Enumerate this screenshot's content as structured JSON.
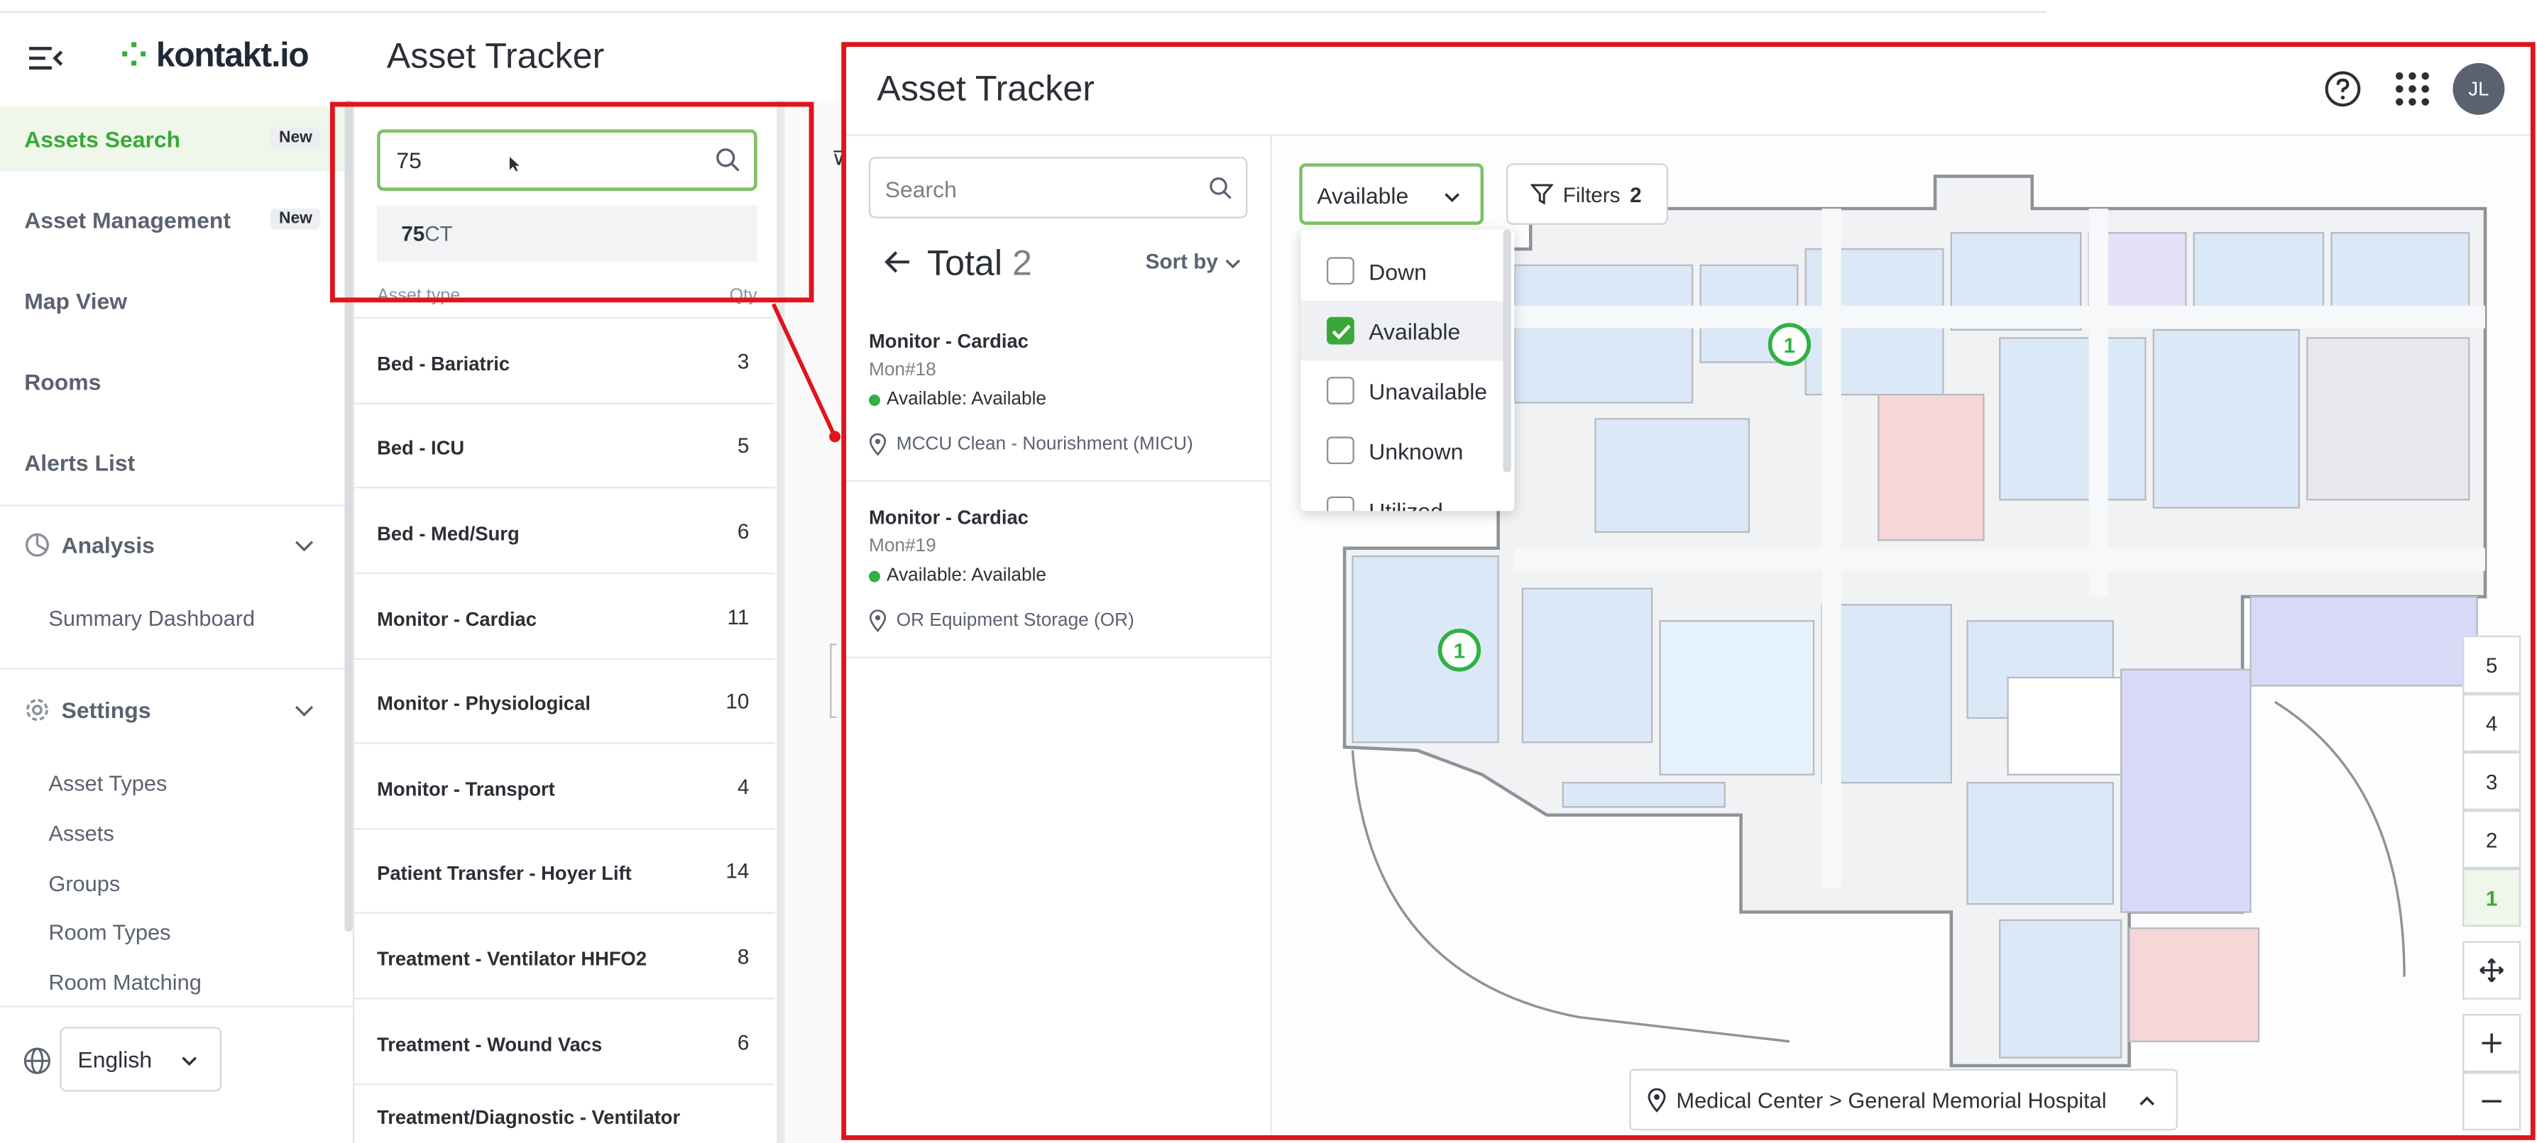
{
  "app": {
    "brand": "kontakt.io",
    "title": "Asset Tracker"
  },
  "sidebar": {
    "items": [
      {
        "label": "Assets Search",
        "badge": "New"
      },
      {
        "label": "Asset Management",
        "badge": "New"
      },
      {
        "label": "Map View"
      },
      {
        "label": "Rooms"
      },
      {
        "label": "Alerts List"
      }
    ],
    "analysis": {
      "label": "Analysis",
      "items": [
        "Summary Dashboard"
      ]
    },
    "settings": {
      "label": "Settings",
      "items": [
        "Asset Types",
        "Assets",
        "Groups",
        "Room Types",
        "Room Matching"
      ]
    },
    "language": "English"
  },
  "asset_search": {
    "query": "75",
    "suggestion_bold": "75",
    "suggestion_rest": "CT",
    "col_type": "Asset type",
    "col_qty": "Qty",
    "rows": [
      {
        "name": "Bed - Bariatric",
        "qty": "3"
      },
      {
        "name": "Bed - ICU",
        "qty": "5"
      },
      {
        "name": "Bed - Med/Surg",
        "qty": "6"
      },
      {
        "name": "Monitor - Cardiac",
        "qty": "11"
      },
      {
        "name": "Monitor - Physiological",
        "qty": "10"
      },
      {
        "name": "Monitor - Transport",
        "qty": "4"
      },
      {
        "name": "Patient Transfer - Hoyer Lift",
        "qty": "14"
      },
      {
        "name": "Treatment - Ventilator HHFO2",
        "qty": "8"
      },
      {
        "name": "Treatment - Wound Vacs",
        "qty": "6"
      },
      {
        "name": "Treatment/Diagnostic - Ventilator",
        "qty": ""
      }
    ]
  },
  "tracker": {
    "title": "Asset Tracker",
    "avatar": "JL",
    "search_placeholder": "Search",
    "total_label": "Total",
    "total_count": "2",
    "sort_label": "Sort by",
    "results": [
      {
        "name": "Monitor - Cardiac",
        "id": "Mon#18",
        "status": "Available: Available",
        "location": "MCCU Clean - Nourishment (MICU)"
      },
      {
        "name": "Monitor - Cardiac",
        "id": "Mon#19",
        "status": "Available: Available",
        "location": "OR Equipment Storage (OR)"
      }
    ],
    "status_filter": "Available",
    "filters_label": "Filters",
    "filters_count": "2",
    "status_options": [
      {
        "label": "Down",
        "checked": false
      },
      {
        "label": "Available",
        "checked": true
      },
      {
        "label": "Unavailable",
        "checked": false
      },
      {
        "label": "Unknown",
        "checked": false
      },
      {
        "label": "Utilized",
        "checked": false
      }
    ],
    "floors": [
      "5",
      "4",
      "3",
      "2",
      "1"
    ],
    "active_floor": "1",
    "map_pins": [
      "1",
      "1"
    ],
    "breadcrumb": "Medical Center > General Memorial Hospital"
  },
  "colors": {
    "accent": "#3aa839",
    "highlight": "#e0141c",
    "status": "#2fb144"
  }
}
